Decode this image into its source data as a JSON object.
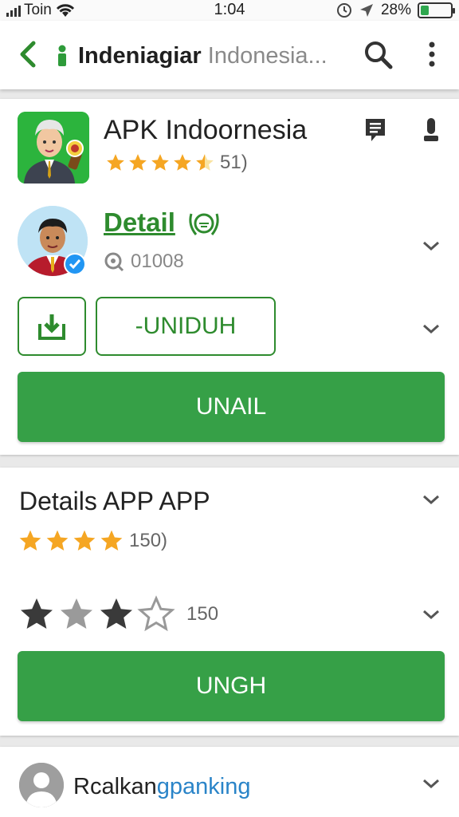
{
  "status_bar": {
    "carrier": "Toin",
    "time": "1:04",
    "battery": "28%",
    "battery_level": 0.28
  },
  "app_bar": {
    "title_bold": "Indeniagiar",
    "title_rest": " Indonesia..."
  },
  "app_card": {
    "title": "APK Indoornesia",
    "rating": 4.5,
    "rating_count": "51)",
    "detail_link": "Detail",
    "views": "01008",
    "unduh_label": "-UNIDUH",
    "primary_label": "UNAIL"
  },
  "details_card": {
    "title": "Details APP APP",
    "rating_a": 4,
    "rating_a_count": "150)",
    "rating_b": 3,
    "rating_b_count": "150",
    "primary_label": "UNGH"
  },
  "user_card": {
    "name_part1": "Rcalkan",
    "name_part2": "gpanking"
  },
  "colors": {
    "accent_green": "#36a047",
    "link_green": "#2e8b2e",
    "star_gold": "#f5a623",
    "star_dark": "#3a3a3a",
    "link_blue": "#2a84c8"
  },
  "icons": [
    "back-arrow-icon",
    "location-marker-icon",
    "search-icon",
    "more-vert-icon",
    "message-icon",
    "mic-icon",
    "laurel-icon",
    "eye-icon",
    "download-icon",
    "chevron-down-icon",
    "user-avatar-icon"
  ]
}
